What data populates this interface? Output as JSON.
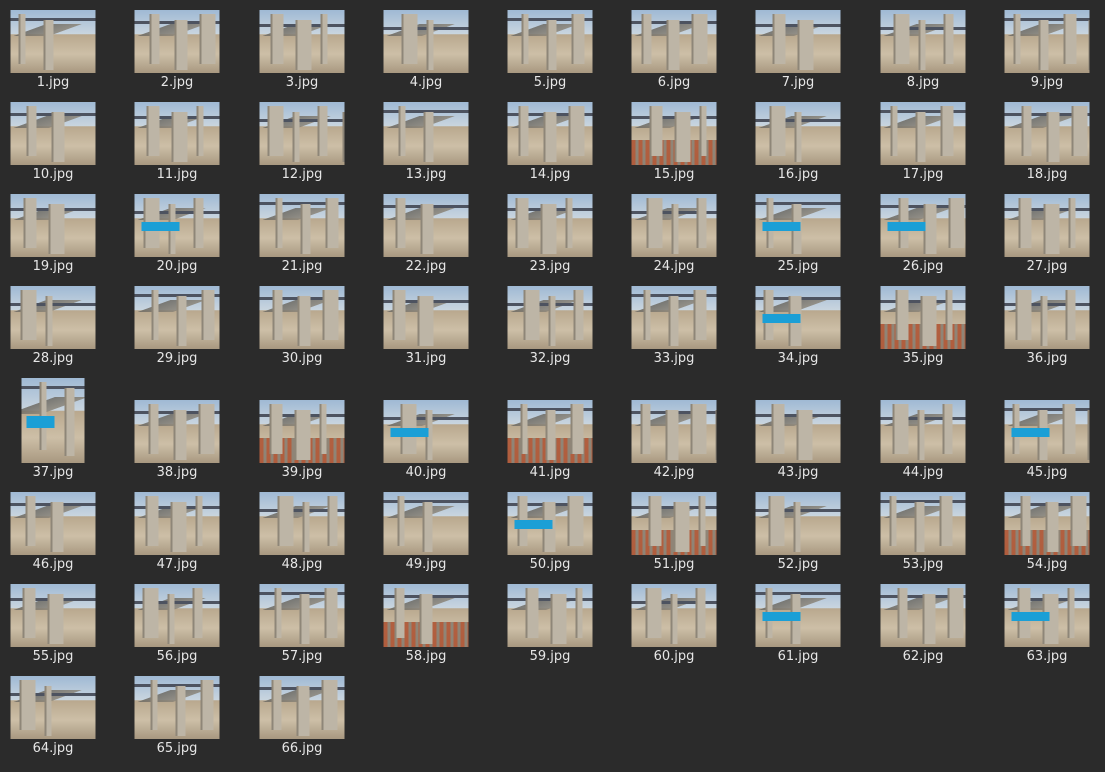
{
  "files": [
    {
      "name": "1.jpg"
    },
    {
      "name": "2.jpg"
    },
    {
      "name": "3.jpg"
    },
    {
      "name": "4.jpg"
    },
    {
      "name": "5.jpg"
    },
    {
      "name": "6.jpg"
    },
    {
      "name": "7.jpg"
    },
    {
      "name": "8.jpg"
    },
    {
      "name": "9.jpg"
    },
    {
      "name": "10.jpg"
    },
    {
      "name": "11.jpg"
    },
    {
      "name": "12.jpg"
    },
    {
      "name": "13.jpg"
    },
    {
      "name": "14.jpg"
    },
    {
      "name": "15.jpg",
      "rebar": true
    },
    {
      "name": "16.jpg"
    },
    {
      "name": "17.jpg"
    },
    {
      "name": "18.jpg"
    },
    {
      "name": "19.jpg"
    },
    {
      "name": "20.jpg",
      "blue": true
    },
    {
      "name": "21.jpg"
    },
    {
      "name": "22.jpg"
    },
    {
      "name": "23.jpg"
    },
    {
      "name": "24.jpg"
    },
    {
      "name": "25.jpg",
      "blue": true
    },
    {
      "name": "26.jpg",
      "blue": true
    },
    {
      "name": "27.jpg"
    },
    {
      "name": "28.jpg"
    },
    {
      "name": "29.jpg"
    },
    {
      "name": "30.jpg"
    },
    {
      "name": "31.jpg"
    },
    {
      "name": "32.jpg"
    },
    {
      "name": "33.jpg"
    },
    {
      "name": "34.jpg",
      "blue": true
    },
    {
      "name": "35.jpg",
      "rebar": true
    },
    {
      "name": "36.jpg"
    },
    {
      "name": "37.jpg",
      "portrait": true,
      "blue": true
    },
    {
      "name": "38.jpg"
    },
    {
      "name": "39.jpg",
      "rebar": true
    },
    {
      "name": "40.jpg",
      "blue": true
    },
    {
      "name": "41.jpg",
      "rebar": true
    },
    {
      "name": "42.jpg"
    },
    {
      "name": "43.jpg"
    },
    {
      "name": "44.jpg"
    },
    {
      "name": "45.jpg",
      "blue": true
    },
    {
      "name": "46.jpg"
    },
    {
      "name": "47.jpg"
    },
    {
      "name": "48.jpg"
    },
    {
      "name": "49.jpg"
    },
    {
      "name": "50.jpg",
      "blue": true
    },
    {
      "name": "51.jpg",
      "rebar": true
    },
    {
      "name": "52.jpg"
    },
    {
      "name": "53.jpg"
    },
    {
      "name": "54.jpg",
      "rebar": true
    },
    {
      "name": "55.jpg"
    },
    {
      "name": "56.jpg"
    },
    {
      "name": "57.jpg"
    },
    {
      "name": "58.jpg",
      "rebar": true
    },
    {
      "name": "59.jpg"
    },
    {
      "name": "60.jpg"
    },
    {
      "name": "61.jpg",
      "blue": true
    },
    {
      "name": "62.jpg"
    },
    {
      "name": "63.jpg",
      "blue": true
    },
    {
      "name": "64.jpg"
    },
    {
      "name": "65.jpg"
    },
    {
      "name": "66.jpg"
    }
  ]
}
